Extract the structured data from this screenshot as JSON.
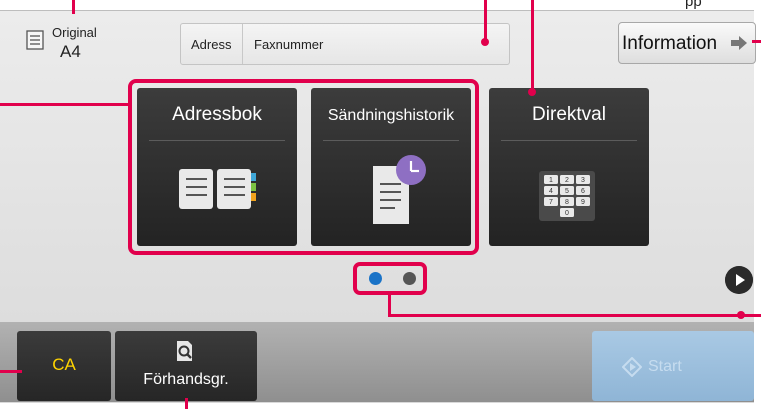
{
  "original": {
    "label": "Original",
    "size": "A4",
    "icon": "document-icon"
  },
  "address_bar": {
    "label": "Adress",
    "value": "Faxnummer"
  },
  "info_button": {
    "label": "Information",
    "icon": "arrow-right-icon"
  },
  "tiles": [
    {
      "label": "Adressbok",
      "icon": "address-book-icon"
    },
    {
      "label": "Sändningshistorik",
      "icon": "history-clock-icon"
    },
    {
      "label": "Direktval",
      "icon": "keypad-icon"
    }
  ],
  "keypad_keys": [
    "1",
    "2",
    "3",
    "4",
    "5",
    "6",
    "7",
    "8",
    "9",
    "0"
  ],
  "pager": {
    "pages": 2,
    "current": 1,
    "next_icon": "play-next-icon"
  },
  "bottom": {
    "ca_label": "CA",
    "preview_label": "Förhandsgr.",
    "preview_icon": "magnifier-document-icon",
    "start_label": "Start",
    "start_icon": "start-diamond-icon"
  },
  "colors": {
    "highlight": "#e1004c",
    "ca_text": "#ffd400",
    "active_dot": "#1a73c7",
    "start_bg": "#9dbfdf"
  },
  "edge_text": "pp"
}
